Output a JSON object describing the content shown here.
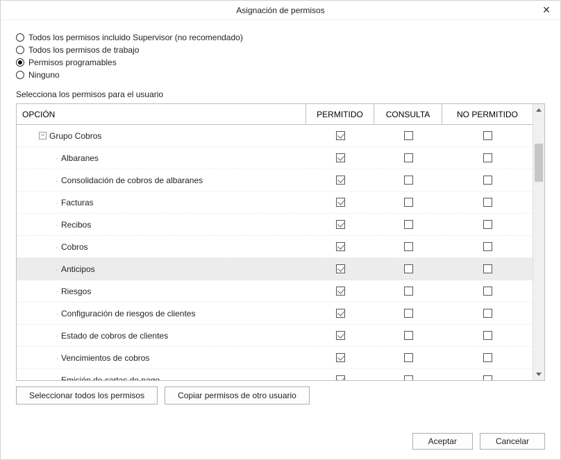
{
  "title": "Asignación de permisos",
  "radios": [
    {
      "label": "Todos los permisos incluido Supervisor (no recomendado)",
      "selected": false
    },
    {
      "label": "Todos los permisos de trabajo",
      "selected": false
    },
    {
      "label": "Permisos programables",
      "selected": true
    },
    {
      "label": "Ninguno",
      "selected": false
    }
  ],
  "subtitle": "Selecciona los permisos para el usuario",
  "headers": {
    "option": "OPCIÓN",
    "allowed": "PERMITIDO",
    "consult": "CONSULTA",
    "denied": "NO PERMITIDO"
  },
  "rows": [
    {
      "label": "Grupo Cobros",
      "type": "group",
      "indent": 2,
      "allowed": true,
      "consult": false,
      "denied": false,
      "highlight": false
    },
    {
      "label": "Albaranes",
      "type": "leaf",
      "indent": 4,
      "allowed": true,
      "consult": false,
      "denied": false,
      "highlight": false
    },
    {
      "label": "Consolidación de cobros de albaranes",
      "type": "leaf",
      "indent": 4,
      "allowed": true,
      "consult": false,
      "denied": false,
      "highlight": false
    },
    {
      "label": "Facturas",
      "type": "leaf",
      "indent": 4,
      "allowed": true,
      "consult": false,
      "denied": false,
      "highlight": false
    },
    {
      "label": "Recibos",
      "type": "leaf",
      "indent": 4,
      "allowed": true,
      "consult": false,
      "denied": false,
      "highlight": false
    },
    {
      "label": "Cobros",
      "type": "leaf",
      "indent": 4,
      "allowed": true,
      "consult": false,
      "denied": false,
      "highlight": false
    },
    {
      "label": "Anticipos",
      "type": "leaf",
      "indent": 4,
      "allowed": true,
      "consult": false,
      "denied": false,
      "highlight": true
    },
    {
      "label": "Riesgos",
      "type": "leaf",
      "indent": 4,
      "allowed": true,
      "consult": false,
      "denied": false,
      "highlight": false
    },
    {
      "label": "Configuración de riesgos de clientes",
      "type": "leaf",
      "indent": 4,
      "allowed": true,
      "consult": false,
      "denied": false,
      "highlight": false
    },
    {
      "label": "Estado de cobros de clientes",
      "type": "leaf",
      "indent": 4,
      "allowed": true,
      "consult": false,
      "denied": false,
      "highlight": false
    },
    {
      "label": "Vencimientos de cobros",
      "type": "leaf",
      "indent": 4,
      "allowed": true,
      "consult": false,
      "denied": false,
      "highlight": false
    },
    {
      "label": "Emisión de cartas de pago",
      "type": "leaf",
      "indent": 4,
      "allowed": true,
      "consult": false,
      "denied": false,
      "highlight": false
    }
  ],
  "toolbar": {
    "select_all": "Seleccionar todos los permisos",
    "copy_from": "Copiar permisos de otro usuario"
  },
  "footer": {
    "ok": "Aceptar",
    "cancel": "Cancelar"
  },
  "expander_glyph": "⊟"
}
